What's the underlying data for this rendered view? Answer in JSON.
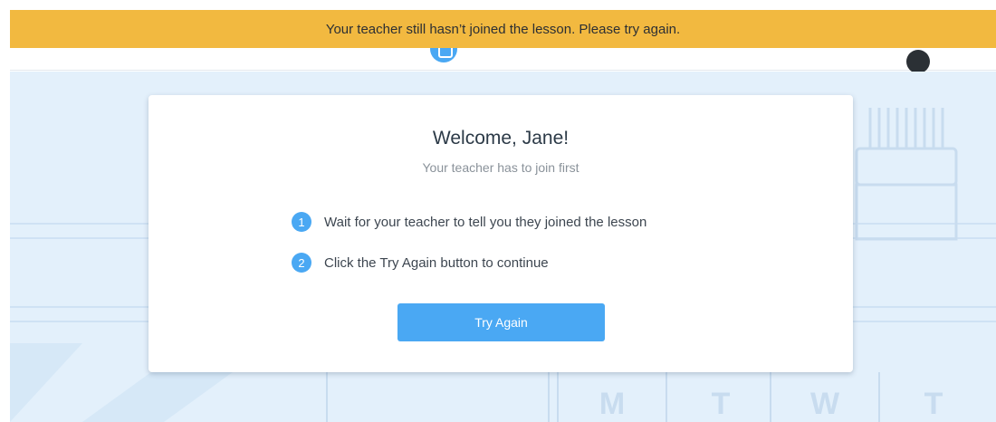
{
  "banner": {
    "message": "Your teacher still hasn’t joined the lesson. Please try again.",
    "color": "#f2b940"
  },
  "header": {
    "logo_icon": "brand-logo-icon",
    "logo_text": "",
    "avatar_icon": "user-avatar"
  },
  "background": {
    "calendar_days": [
      "M",
      "T",
      "W",
      "T"
    ],
    "color": "#e3f0fb"
  },
  "card": {
    "title": "Welcome, Jane!",
    "subtitle": "Your teacher has to join first",
    "steps": [
      {
        "number": "1",
        "text": "Wait for your teacher to tell you they joined the lesson"
      },
      {
        "number": "2",
        "text": "Click the Try Again button to continue"
      }
    ],
    "button_label": "Try Again",
    "accent_color": "#4aa8f3"
  }
}
